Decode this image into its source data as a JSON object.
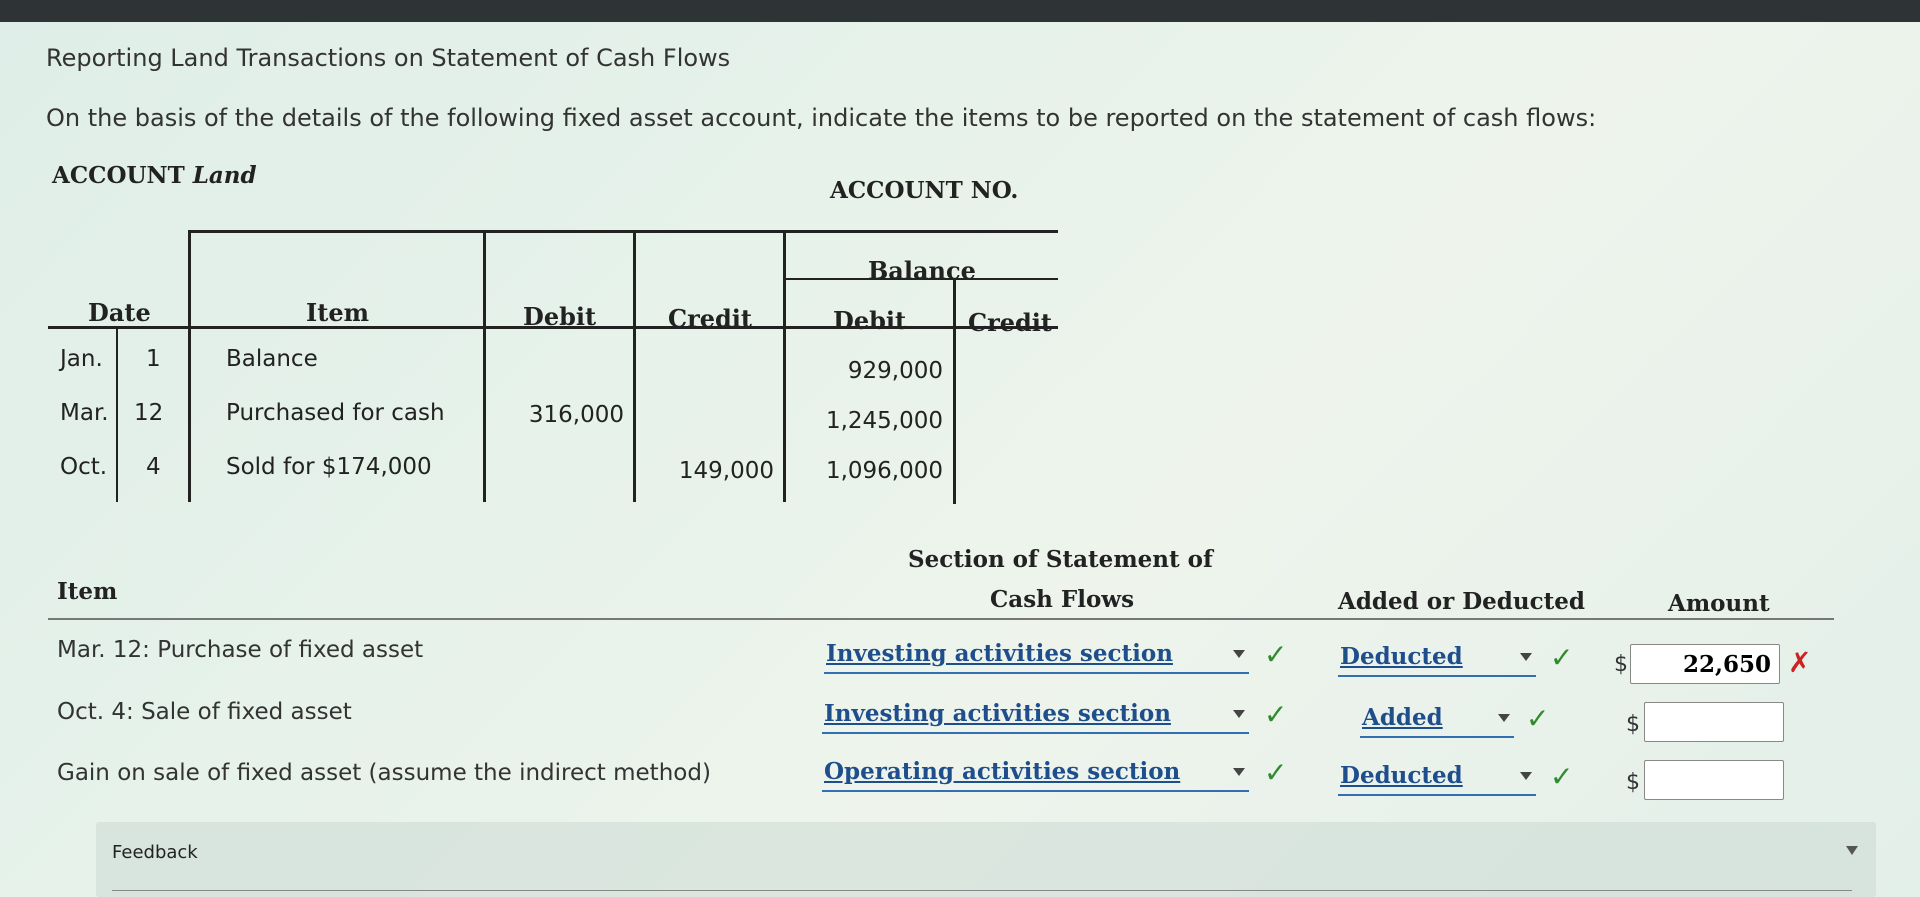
{
  "title": "Reporting Land Transactions on Statement of Cash Flows",
  "instruction": "On the basis of the details of the following fixed asset account, indicate the items to be reported on the statement of cash flows:",
  "account": {
    "label": "ACCOUNT",
    "name": "Land",
    "number_label": "ACCOUNT NO."
  },
  "ledger": {
    "headers": {
      "date": "Date",
      "item": "Item",
      "debit": "Debit",
      "credit": "Credit",
      "balance": "Balance",
      "balance_debit": "Debit",
      "balance_credit": "Credit"
    },
    "rows": [
      {
        "month": "Jan.",
        "day": "1",
        "item": "Balance",
        "debit": "",
        "credit": "",
        "balance_debit": "929,000",
        "balance_credit": ""
      },
      {
        "month": "Mar.",
        "day": "12",
        "item": "Purchased for cash",
        "debit": "316,000",
        "credit": "",
        "balance_debit": "1,245,000",
        "balance_credit": ""
      },
      {
        "month": "Oct.",
        "day": "4",
        "item": "Sold for $174,000",
        "debit": "",
        "credit": "149,000",
        "balance_debit": "1,096,000",
        "balance_credit": ""
      }
    ]
  },
  "answer_table": {
    "headers": {
      "item": "Item",
      "section_line1": "Section of Statement of",
      "section_line2": "Cash Flows",
      "added_deducted": "Added or Deducted",
      "amount": "Amount"
    },
    "rows": [
      {
        "item": "Mar. 12: Purchase of fixed asset",
        "section": "Investing activities section",
        "added_deducted": "Deducted",
        "currency": "$",
        "amount": "22,650"
      },
      {
        "item": "Oct. 4: Sale of fixed asset",
        "section": "Investing activities section",
        "added_deducted": "Added",
        "currency": "$",
        "amount": ""
      },
      {
        "item": "Gain on sale of fixed asset (assume the indirect method)",
        "section": "Operating activities section",
        "added_deducted": "Deducted",
        "currency": "$",
        "amount": ""
      }
    ],
    "marks": {
      "check": "✓",
      "wrong": "✗"
    }
  },
  "feedback": {
    "label": "Feedback"
  },
  "colors": {
    "link": "#1f4e8c",
    "check": "#2e8b2e",
    "wrong": "#cc2222"
  }
}
